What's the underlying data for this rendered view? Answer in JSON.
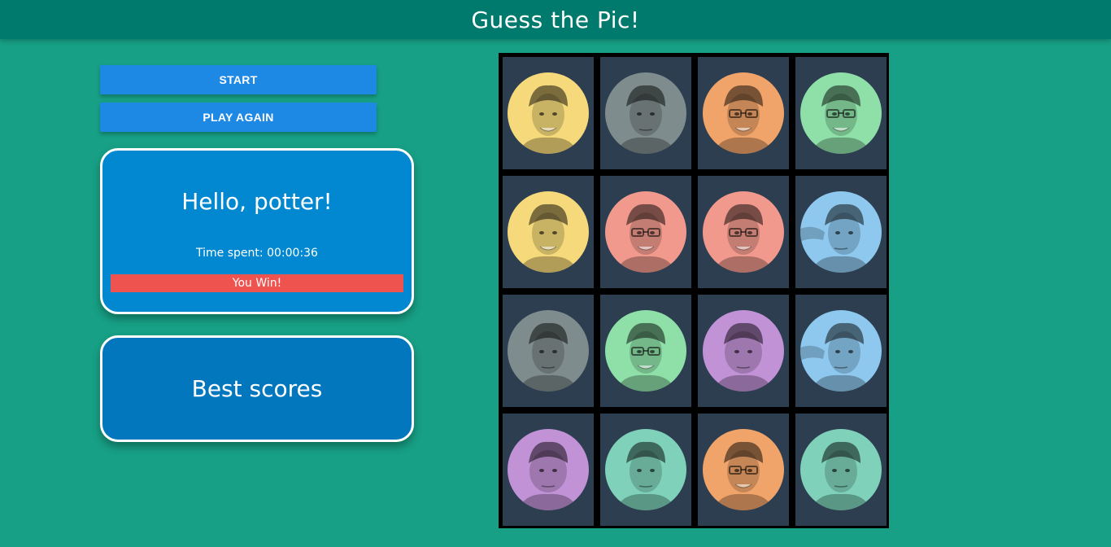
{
  "header": {
    "title": "Guess the Pic!"
  },
  "controls": {
    "start_label": "START",
    "play_again_label": "PLAY AGAIN"
  },
  "status": {
    "greeting": "Hello, potter!",
    "time_spent": "Time spent: 00:00:36",
    "result": "You Win!"
  },
  "best_scores": {
    "label": "Best scores"
  },
  "colors": {
    "yellow": "#f5d97a",
    "gray": "#7f8c8d",
    "orange": "#f0a46a",
    "green": "#8ee0a8",
    "red": "#f0998c",
    "blue": "#8ec8ee",
    "purple": "#c192d6",
    "teal": "#7fd1b9"
  },
  "board": {
    "rows": [
      [
        {
          "color": "yellow",
          "face": "smile"
        },
        {
          "color": "gray",
          "face": "plain"
        },
        {
          "color": "orange",
          "face": "glasses"
        },
        {
          "color": "green",
          "face": "glasses"
        }
      ],
      [
        {
          "color": "yellow",
          "face": "smile"
        },
        {
          "color": "red",
          "face": "glasses"
        },
        {
          "color": "red",
          "face": "glasses"
        },
        {
          "color": "blue",
          "face": "side"
        }
      ],
      [
        {
          "color": "gray",
          "face": "plain"
        },
        {
          "color": "green",
          "face": "glasses"
        },
        {
          "color": "purple",
          "face": "round"
        },
        {
          "color": "blue",
          "face": "side"
        }
      ],
      [
        {
          "color": "purple",
          "face": "round"
        },
        {
          "color": "teal",
          "face": "plain"
        },
        {
          "color": "orange",
          "face": "glasses"
        },
        {
          "color": "teal",
          "face": "plain"
        }
      ]
    ]
  }
}
